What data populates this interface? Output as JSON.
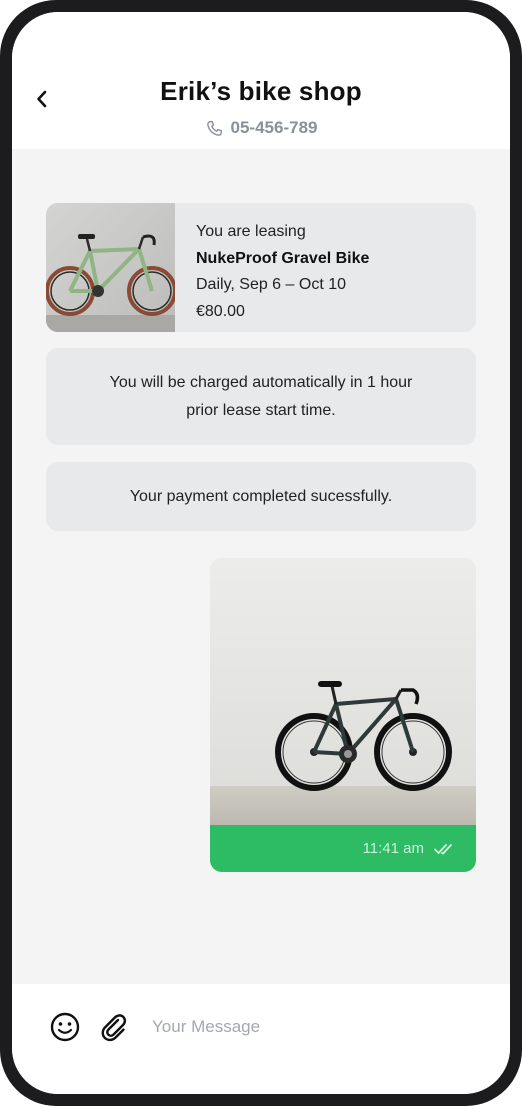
{
  "header": {
    "title": "Erik’s bike shop",
    "phone": "05-456-789",
    "back_icon": "chevron-left-icon",
    "phone_icon": "phone-icon"
  },
  "lease": {
    "intro": "You are leasing",
    "product": "NukeProof Gravel Bike",
    "period": "Daily, Sep 6 – Oct 10",
    "price": "€80.00",
    "image": "green-gravel-bike"
  },
  "messages": {
    "charge_notice": "You will be charged automatically in 1 hour prior lease start time.",
    "payment_notice": "Your payment completed sucessfully.",
    "photo_time": "11:41 am",
    "photo_status_icon": "double-check-icon",
    "photo_image": "black-fixie-bike"
  },
  "composer": {
    "placeholder": "Your Message",
    "value": "",
    "emoji_icon": "smiley-icon",
    "attach_icon": "paperclip-icon"
  },
  "colors": {
    "accent_green": "#2DBB63",
    "bubble_gray": "#E8E9EB",
    "background": "#F4F4F5"
  }
}
